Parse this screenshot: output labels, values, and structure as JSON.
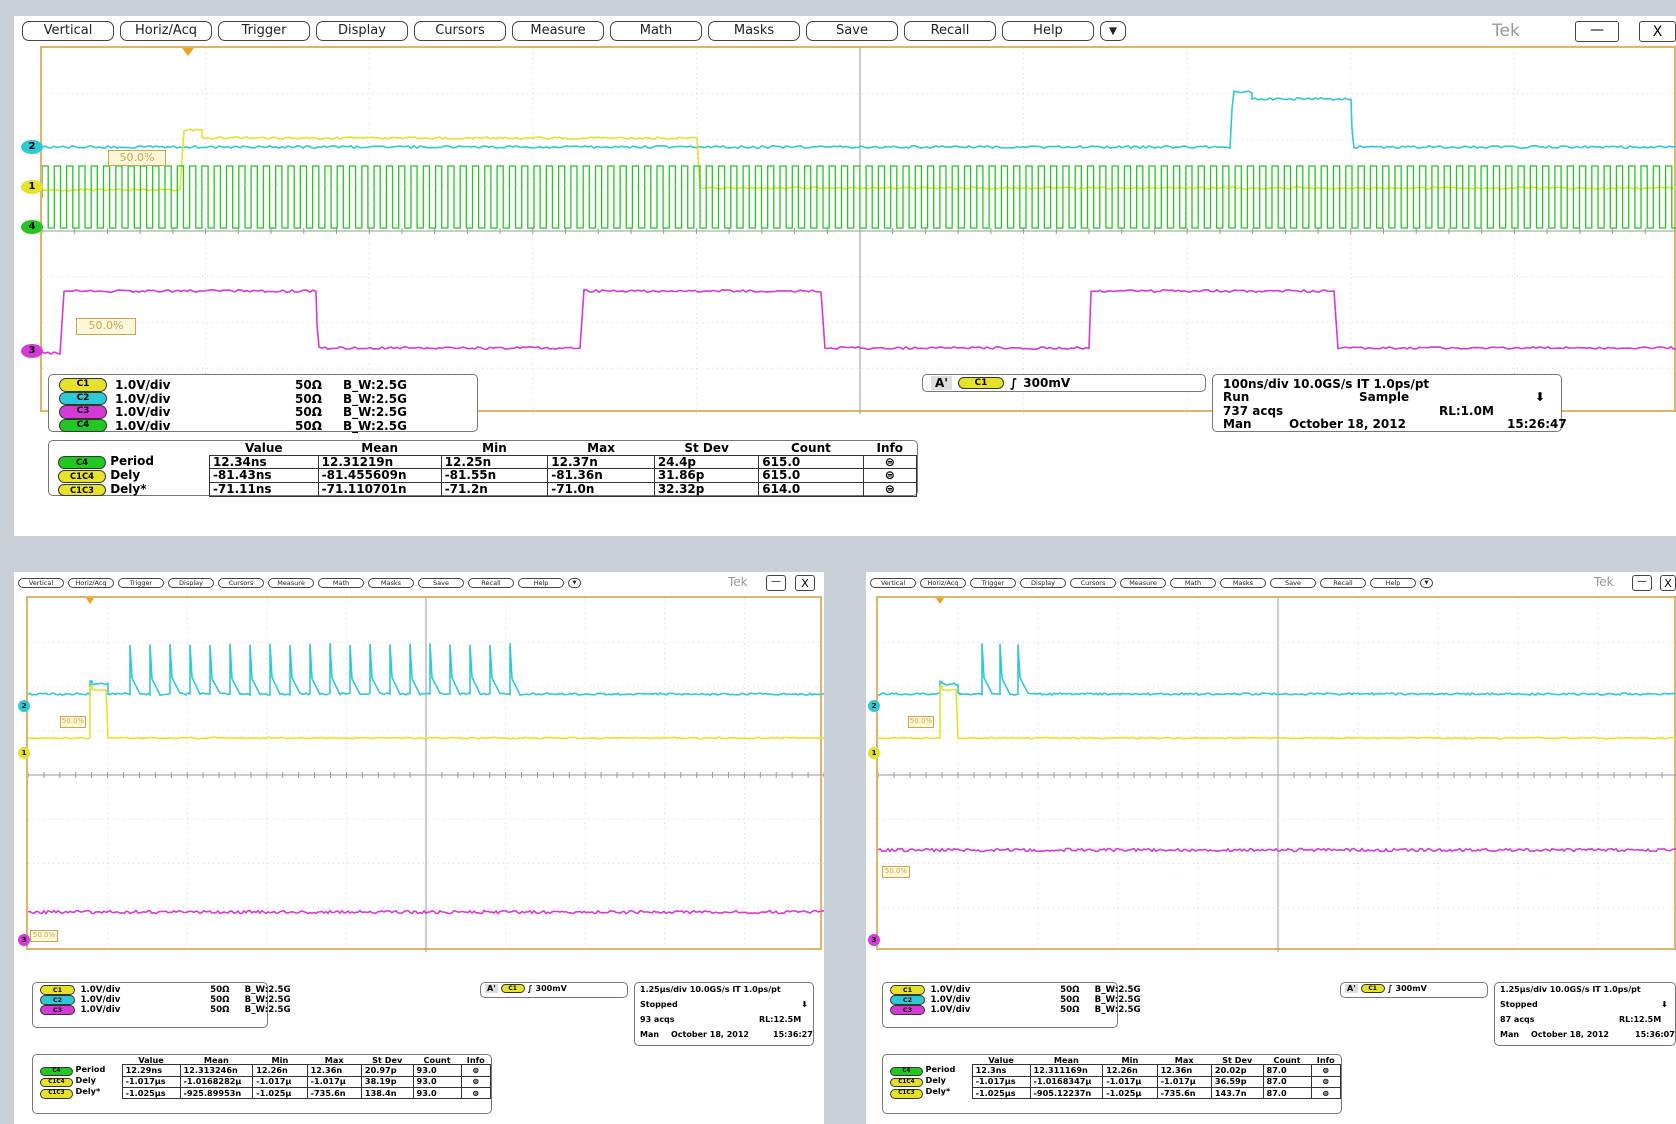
{
  "menu": [
    "Vertical",
    "Horiz/Acq",
    "Trigger",
    "Display",
    "Cursors",
    "Measure",
    "Math",
    "Masks",
    "Save",
    "Recall",
    "Help"
  ],
  "menu_arrow": "▼",
  "brand": "Tek",
  "window_buttons": {
    "minimize": "—",
    "close": "X"
  },
  "colors": {
    "c1": "#e6e22a",
    "c2": "#2ec9d6",
    "c3": "#d43ad6",
    "c4": "#22c722",
    "graticule": "#e0b56a",
    "background": "#c9d0d7"
  },
  "scopes": [
    {
      "id": "top",
      "channel_markers": [
        "2",
        "1",
        "4",
        "3"
      ],
      "ref_labels": [
        "50.0%",
        "50.0%"
      ],
      "channels": [
        {
          "pill": "C1",
          "scale": "1.0V/div",
          "imp": "50Ω",
          "bw": "B_W:2.5G"
        },
        {
          "pill": "C2",
          "scale": "1.0V/div",
          "imp": "50Ω",
          "bw": "B_W:2.5G"
        },
        {
          "pill": "C3",
          "scale": "1.0V/div",
          "imp": "50Ω",
          "bw": "B_W:2.5G"
        },
        {
          "pill": "C4",
          "scale": "1.0V/div",
          "imp": "50Ω",
          "bw": "B_W:2.5G"
        }
      ],
      "trigger": {
        "label": "A'",
        "pill": "C1",
        "level": "300mV"
      },
      "acq": {
        "line1": "100ns/div   10.0GS/s  IT     1.0ps/pt",
        "run": "Run",
        "mode": "Sample",
        "acqs": "737 acqs",
        "rl": "RL:1.0M",
        "man": "Man",
        "date": "October 18, 2012",
        "time": "15:26:47"
      },
      "meas_headers": [
        "",
        "Value",
        "Mean",
        "Min",
        "Max",
        "St Dev",
        "Count",
        "Info"
      ],
      "meas": [
        {
          "pill": "C4",
          "name": "Period",
          "value": "12.34ns",
          "mean": "12.31219n",
          "min": "12.25n",
          "max": "12.37n",
          "stdev": "24.4p",
          "count": "615.0"
        },
        {
          "pill": "C1C4",
          "name": "Dely",
          "value": "-81.43ns",
          "mean": "-81.455609n",
          "min": "-81.55n",
          "max": "-81.36n",
          "stdev": "31.86p",
          "count": "615.0"
        },
        {
          "pill": "C1C3",
          "name": "Dely*",
          "value": "-71.11ns",
          "mean": "-71.110701n",
          "min": "-71.2n",
          "max": "-71.0n",
          "stdev": "32.32p",
          "count": "614.0"
        }
      ]
    },
    {
      "id": "bottom-left",
      "channel_markers": [
        "2",
        "1",
        "3"
      ],
      "ref_labels": [
        "50.0%",
        "50.0%"
      ],
      "channels": [
        {
          "pill": "C1",
          "scale": "1.0V/div",
          "imp": "50Ω",
          "bw": "B_W:2.5G"
        },
        {
          "pill": "C2",
          "scale": "1.0V/div",
          "imp": "50Ω",
          "bw": "B_W:2.5G"
        },
        {
          "pill": "C3",
          "scale": "1.0V/div",
          "imp": "50Ω",
          "bw": "B_W:2.5G"
        }
      ],
      "trigger": {
        "label": "A'",
        "pill": "C1",
        "level": "300mV"
      },
      "acq": {
        "line1": "1.25μs/div 10.0GS/s  IT   1.0ps/pt",
        "run": "Stopped",
        "mode": "",
        "acqs": "93 acqs",
        "rl": "RL:12.5M",
        "man": "Man",
        "date": "October 18, 2012",
        "time": "15:36:27"
      },
      "meas_headers": [
        "",
        "Value",
        "Mean",
        "Min",
        "Max",
        "St Dev",
        "Count",
        "Info"
      ],
      "meas": [
        {
          "pill": "C4",
          "name": "Period",
          "value": "12.29ns",
          "mean": "12.313246n",
          "min": "12.26n",
          "max": "12.36n",
          "stdev": "20.97p",
          "count": "93.0"
        },
        {
          "pill": "C1C4",
          "name": "Dely",
          "value": "-1.017μs",
          "mean": "-1.0168282μ",
          "min": "-1.017μ",
          "max": "-1.017μ",
          "stdev": "38.19p",
          "count": "93.0"
        },
        {
          "pill": "C1C3",
          "name": "Dely*",
          "value": "-1.025μs",
          "mean": "-925.89953n",
          "min": "-1.025μ",
          "max": "-735.6n",
          "stdev": "138.4n",
          "count": "93.0"
        }
      ]
    },
    {
      "id": "bottom-right",
      "channel_markers": [
        "2",
        "1",
        "3"
      ],
      "ref_labels": [
        "50.0%",
        "50.0%"
      ],
      "channels": [
        {
          "pill": "C1",
          "scale": "1.0V/div",
          "imp": "50Ω",
          "bw": "B_W:2.5G"
        },
        {
          "pill": "C2",
          "scale": "1.0V/div",
          "imp": "50Ω",
          "bw": "B_W:2.5G"
        },
        {
          "pill": "C3",
          "scale": "1.0V/div",
          "imp": "50Ω",
          "bw": "B_W:2.5G"
        }
      ],
      "trigger": {
        "label": "A'",
        "pill": "C1",
        "level": "300mV"
      },
      "acq": {
        "line1": "1.25μs/div 10.0GS/s  IT   1.0ps/pt",
        "run": "Stopped",
        "mode": "",
        "acqs": "87 acqs",
        "rl": "RL:12.5M",
        "man": "Man",
        "date": "October 18, 2012",
        "time": "15:36:07"
      },
      "meas_headers": [
        "",
        "Value",
        "Mean",
        "Min",
        "Max",
        "St Dev",
        "Count",
        "Info"
      ],
      "meas": [
        {
          "pill": "C4",
          "name": "Period",
          "value": "12.3ns",
          "mean": "12.311169n",
          "min": "12.26n",
          "max": "12.36n",
          "stdev": "20.02p",
          "count": "87.0"
        },
        {
          "pill": "C1C4",
          "name": "Dely",
          "value": "-1.017μs",
          "mean": "-1.0168347μ",
          "min": "-1.017μ",
          "max": "-1.017μ",
          "stdev": "36.59p",
          "count": "87.0"
        },
        {
          "pill": "C1C3",
          "name": "Dely*",
          "value": "-1.025μs",
          "mean": "-905.12237n",
          "min": "-1.025μ",
          "max": "-735.6n",
          "stdev": "143.7n",
          "count": "87.0"
        }
      ]
    }
  ]
}
